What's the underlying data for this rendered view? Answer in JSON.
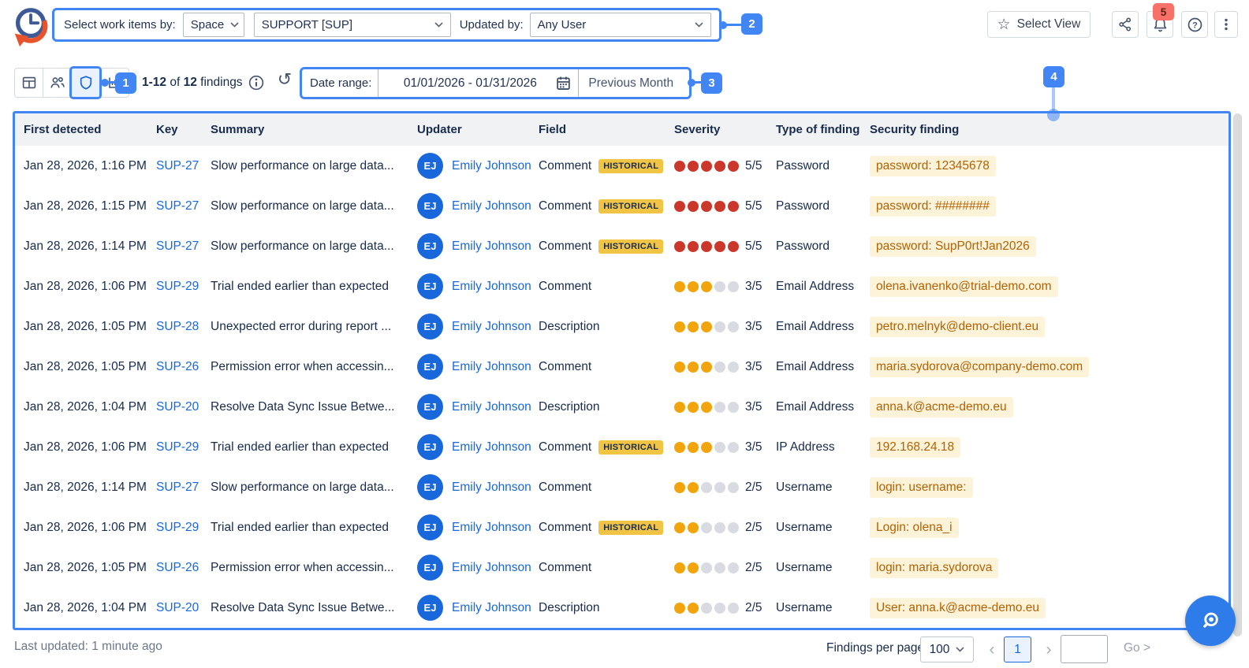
{
  "header": {
    "filter": {
      "select_label": "Select work items by:",
      "mode_value": "Space",
      "space_value": "SUPPORT [SUP]",
      "updated_by_label": "Updated by:",
      "user_value": "Any User"
    },
    "select_view_label": "Select View",
    "notification_count": "5"
  },
  "toolbar": {
    "findings": {
      "range": "1-12",
      "of_text": " of ",
      "total": "12",
      "suffix": " findings"
    },
    "date_range_label": "Date range:",
    "date_range_value": "01/01/2026 - 01/31/2026",
    "period_preset": "Previous Month"
  },
  "annotations": {
    "badge1": "1",
    "badge2": "2",
    "badge3": "3",
    "badge4": "4"
  },
  "table": {
    "columns": [
      "First detected",
      "Key",
      "Summary",
      "Updater",
      "Field",
      "Severity",
      "Type of finding",
      "Security finding"
    ],
    "historical_label": "HISTORICAL",
    "rows": [
      {
        "detected": "Jan 28, 2026, 1:16 PM",
        "key": "SUP-27",
        "summary": "Slow performance on large data...",
        "initials": "EJ",
        "updater": "Emily Johnson",
        "field": "Comment",
        "historical": true,
        "severity": {
          "score": 5,
          "label": "5/5",
          "color": "red"
        },
        "type": "Password",
        "finding": "password: 12345678"
      },
      {
        "detected": "Jan 28, 2026, 1:15 PM",
        "key": "SUP-27",
        "summary": "Slow performance on large data...",
        "initials": "EJ",
        "updater": "Emily Johnson",
        "field": "Comment",
        "historical": true,
        "severity": {
          "score": 5,
          "label": "5/5",
          "color": "red"
        },
        "type": "Password",
        "finding": "password: ########"
      },
      {
        "detected": "Jan 28, 2026, 1:14 PM",
        "key": "SUP-27",
        "summary": "Slow performance on large data...",
        "initials": "EJ",
        "updater": "Emily Johnson",
        "field": "Comment",
        "historical": true,
        "severity": {
          "score": 5,
          "label": "5/5",
          "color": "red"
        },
        "type": "Password",
        "finding": "password: SupP0rt!Jan2026"
      },
      {
        "detected": "Jan 28, 2026, 1:06 PM",
        "key": "SUP-29",
        "summary": "Trial ended earlier than expected",
        "initials": "EJ",
        "updater": "Emily Johnson",
        "field": "Comment",
        "historical": false,
        "severity": {
          "score": 3,
          "label": "3/5",
          "color": "yellow"
        },
        "type": "Email Address",
        "finding": "olena.ivanenko@trial-demo.com"
      },
      {
        "detected": "Jan 28, 2026, 1:05 PM",
        "key": "SUP-28",
        "summary": "Unexpected error during report ...",
        "initials": "EJ",
        "updater": "Emily Johnson",
        "field": "Description",
        "historical": false,
        "severity": {
          "score": 3,
          "label": "3/5",
          "color": "yellow"
        },
        "type": "Email Address",
        "finding": "petro.melnyk@demo-client.eu"
      },
      {
        "detected": "Jan 28, 2026, 1:05 PM",
        "key": "SUP-26",
        "summary": "Permission error when accessin...",
        "initials": "EJ",
        "updater": "Emily Johnson",
        "field": "Comment",
        "historical": false,
        "severity": {
          "score": 3,
          "label": "3/5",
          "color": "yellow"
        },
        "type": "Email Address",
        "finding": "maria.sydorova@company-demo.com"
      },
      {
        "detected": "Jan 28, 2026, 1:04 PM",
        "key": "SUP-20",
        "summary": "Resolve Data Sync Issue Betwe...",
        "initials": "EJ",
        "updater": "Emily Johnson",
        "field": "Description",
        "historical": false,
        "severity": {
          "score": 3,
          "label": "3/5",
          "color": "yellow"
        },
        "type": "Email Address",
        "finding": "anna.k@acme-demo.eu"
      },
      {
        "detected": "Jan 28, 2026, 1:06 PM",
        "key": "SUP-29",
        "summary": "Trial ended earlier than expected",
        "initials": "EJ",
        "updater": "Emily Johnson",
        "field": "Comment",
        "historical": true,
        "severity": {
          "score": 3,
          "label": "3/5",
          "color": "yellow"
        },
        "type": "IP Address",
        "finding": "192.168.24.18"
      },
      {
        "detected": "Jan 28, 2026, 1:14 PM",
        "key": "SUP-27",
        "summary": "Slow performance on large data...",
        "initials": "EJ",
        "updater": "Emily Johnson",
        "field": "Comment",
        "historical": false,
        "severity": {
          "score": 2,
          "label": "2/5",
          "color": "yellow"
        },
        "type": "Username",
        "finding": "login: username:"
      },
      {
        "detected": "Jan 28, 2026, 1:06 PM",
        "key": "SUP-29",
        "summary": "Trial ended earlier than expected",
        "initials": "EJ",
        "updater": "Emily Johnson",
        "field": "Comment",
        "historical": true,
        "severity": {
          "score": 2,
          "label": "2/5",
          "color": "yellow"
        },
        "type": "Username",
        "finding": "Login: olena_i"
      },
      {
        "detected": "Jan 28, 2026, 1:05 PM",
        "key": "SUP-26",
        "summary": "Permission error when accessin...",
        "initials": "EJ",
        "updater": "Emily Johnson",
        "field": "Comment",
        "historical": false,
        "severity": {
          "score": 2,
          "label": "2/5",
          "color": "yellow"
        },
        "type": "Username",
        "finding": "login: maria.sydorova"
      },
      {
        "detected": "Jan 28, 2026, 1:04 PM",
        "key": "SUP-20",
        "summary": "Resolve Data Sync Issue Betwe...",
        "initials": "EJ",
        "updater": "Emily Johnson",
        "field": "Description",
        "historical": false,
        "severity": {
          "score": 2,
          "label": "2/5",
          "color": "yellow"
        },
        "type": "Username",
        "finding": "User: anna.k@acme-demo.eu"
      }
    ]
  },
  "footer": {
    "last_updated": "Last updated: 1 minute ago",
    "per_page_label": "Findings per page:",
    "per_page_value": "100",
    "current_page": "1",
    "go_label": "Go >"
  },
  "icons": {
    "logo": "clock-history-logo",
    "view_modes": [
      "table-view-icon",
      "people-view-icon",
      "shield-view-icon",
      "chart-view-icon"
    ],
    "toolbar": [
      "info-icon",
      "refresh-icon",
      "calendar-icon"
    ],
    "header_actions": [
      "star-icon",
      "share-icon",
      "bell-icon",
      "help-icon",
      "kebab-menu-icon"
    ],
    "fab": "scanner-search-icon"
  },
  "colors": {
    "vars": {
      "annotation": "#4285F4",
      "link": "#1868DB",
      "text": "#172B4D",
      "muted": "#44546F",
      "sev-red": "#CC372B",
      "sev-yellow": "#F1A40B",
      "sev-empty": "#D8DBE1",
      "hist-bg": "#F2C444",
      "hist-text": "#172B4D",
      "finding-bg": "#FDF3D8",
      "finding-text": "#B26205",
      "notif-bg": "#F87168",
      "avatar-bg": "#1868DB",
      "fab-bg": "#2E7CE9"
    }
  }
}
